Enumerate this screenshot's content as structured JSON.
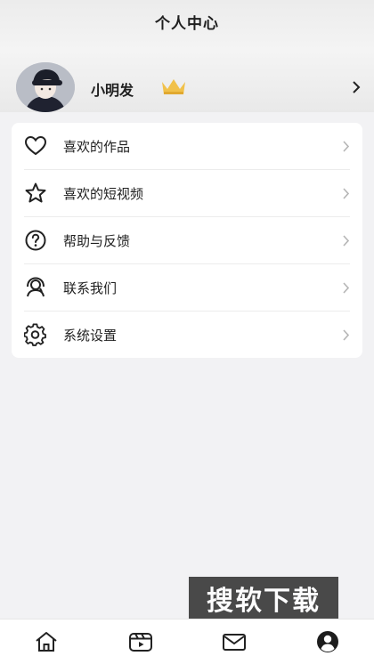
{
  "header": {
    "title": "个人中心"
  },
  "profile": {
    "username": "小明发"
  },
  "menu": [
    {
      "label": "喜欢的作品",
      "icon": "heart-icon"
    },
    {
      "label": "喜欢的短视频",
      "icon": "star-icon"
    },
    {
      "label": "帮助与反馈",
      "icon": "help-icon"
    },
    {
      "label": "联系我们",
      "icon": "contact-icon"
    },
    {
      "label": "系统设置",
      "icon": "settings-icon"
    }
  ],
  "tabbar": {
    "tabs": [
      {
        "icon": "home-icon"
      },
      {
        "icon": "video-icon"
      },
      {
        "icon": "mail-icon"
      },
      {
        "icon": "profile-icon",
        "active": true
      }
    ]
  },
  "watermark": {
    "text": "搜软下载"
  },
  "colors": {
    "background": "#f2f2f4",
    "card": "#ffffff",
    "crown": "#f1c14a",
    "text": "#1f1f1f"
  }
}
